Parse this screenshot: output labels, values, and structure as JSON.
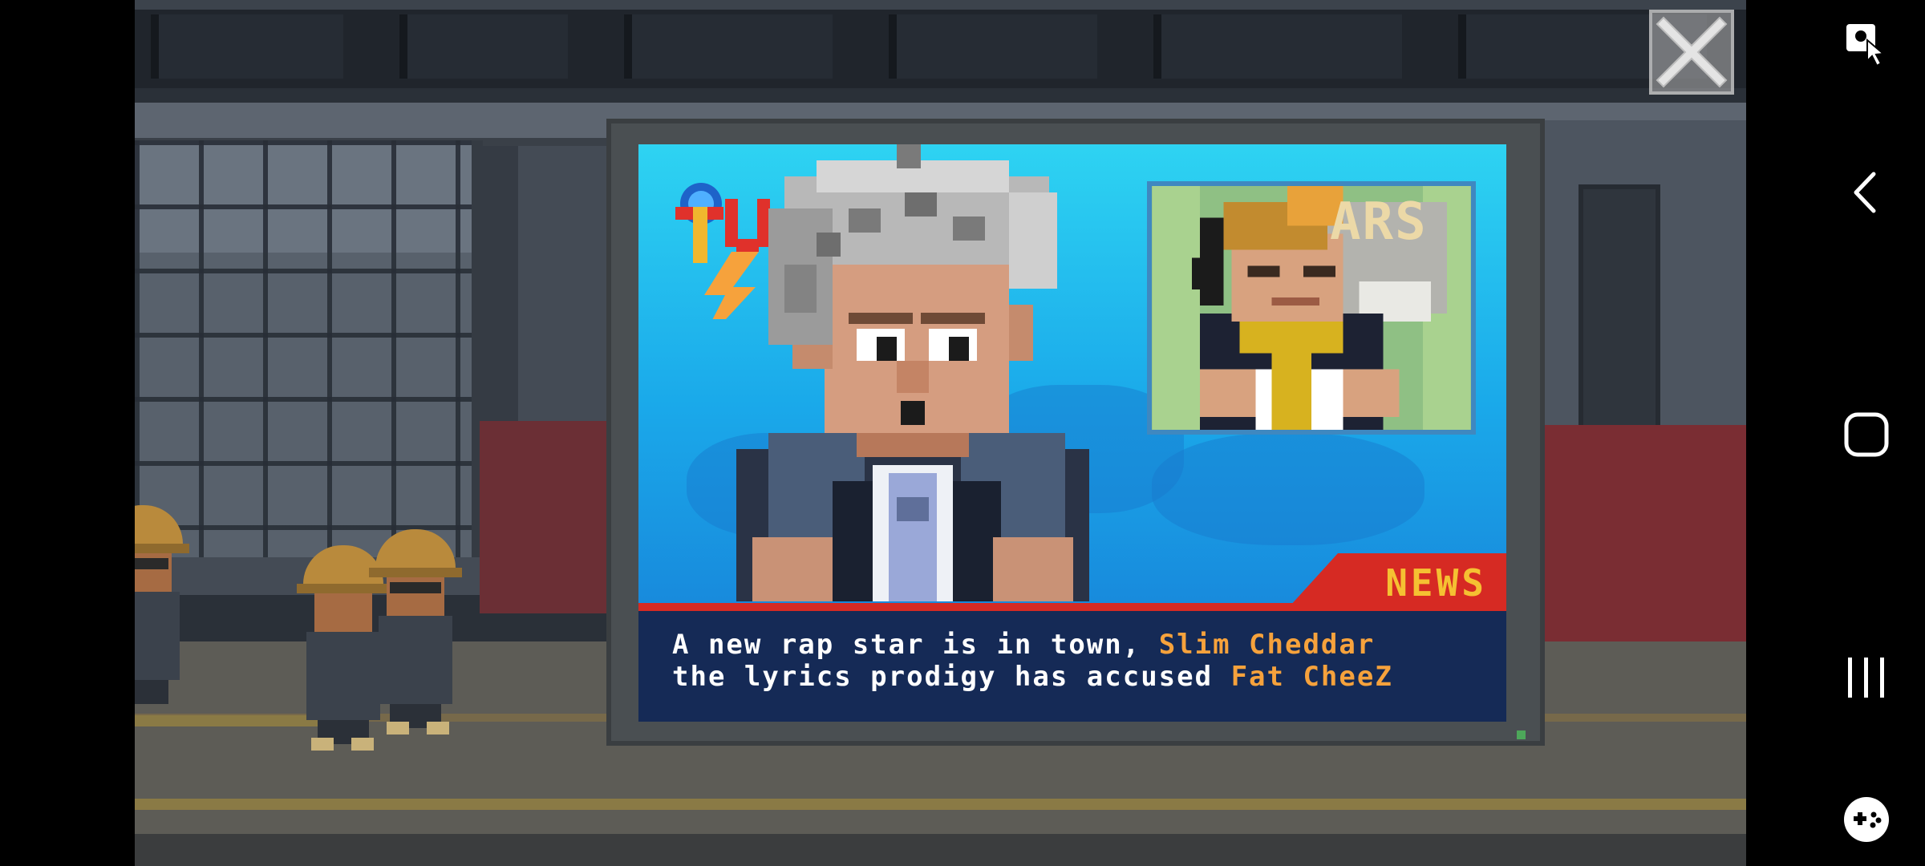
{
  "tv": {
    "logo_text": "TV",
    "news_label": "NEWS",
    "inset_sign_text": "ARS",
    "ticker": {
      "line1_text": "A new rap star is in town, ",
      "line1_highlight": "Slim Cheddar",
      "line2_text": "the lyrics prodigy has accused ",
      "line2_highlight": "Fat CheeZ"
    }
  },
  "icons": {
    "close": "close-icon",
    "assist": "touch-assist-icon",
    "back": "back-icon",
    "home": "home-icon",
    "recents": "recents-icon",
    "gamepad": "game-launcher-icon"
  },
  "colors": {
    "screen_top": "#2ed3f2",
    "screen_bottom": "#1778d4",
    "news_red": "#d62a23",
    "news_gold": "#f5c132",
    "ticker_bg": "#152a56",
    "highlight": "#f6a23c"
  }
}
